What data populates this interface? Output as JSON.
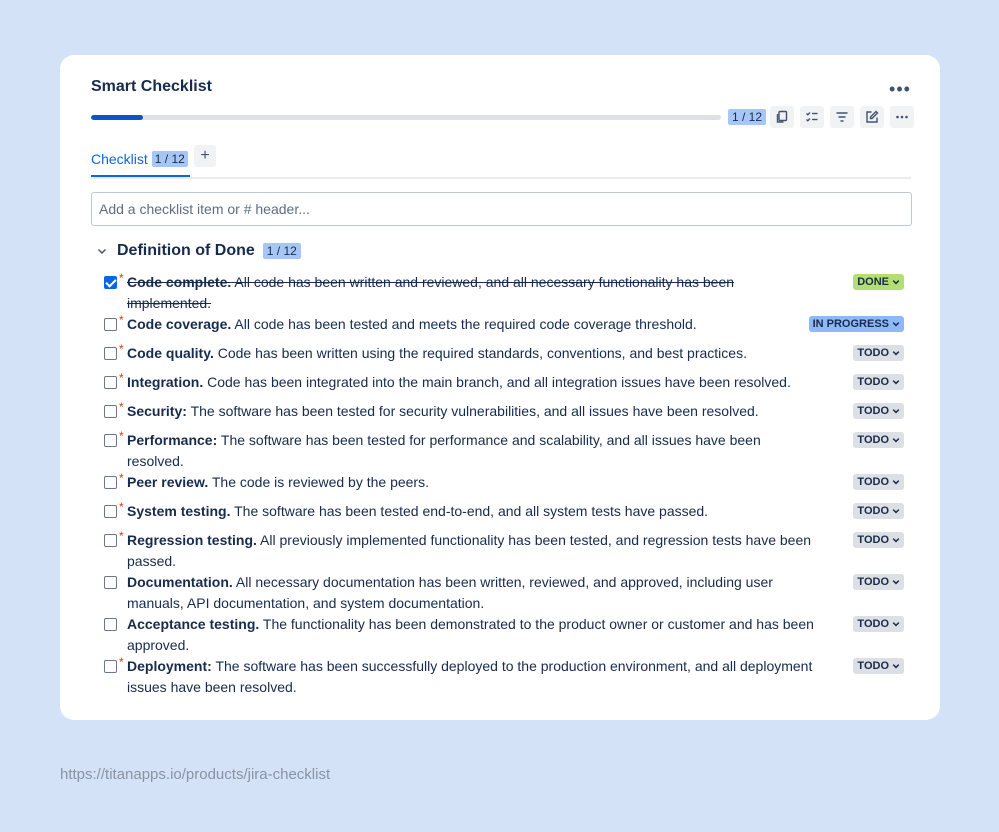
{
  "card": {
    "title": "Smart Checklist",
    "progress": {
      "done": 1,
      "total": 12,
      "fraction": 0.083,
      "label": "1 / 12"
    },
    "toolbar_icons": [
      "copy-icon",
      "checklist-icon",
      "filter-icon",
      "edit-icon",
      "more-icon"
    ]
  },
  "tabs": [
    {
      "label": "Checklist",
      "count": "1 / 12",
      "active": true
    }
  ],
  "tab_add": "+",
  "add_item": {
    "placeholder": "Add a checklist item or # header...",
    "value": ""
  },
  "section": {
    "title": "Definition of Done",
    "count": "1 / 12"
  },
  "items": [
    {
      "title": "Code complete.",
      "description": "All code has been written and reviewed, and all necessary functionality has been implemented.",
      "required": true,
      "checked": true,
      "status": "DONE"
    },
    {
      "title": "Code coverage.",
      "description": "All code has been tested and meets the required code coverage threshold.",
      "required": true,
      "checked": false,
      "status": "IN PROGRESS"
    },
    {
      "title": "Code quality.",
      "description": "Code has been written using the required standards, conventions, and best practices.",
      "required": true,
      "checked": false,
      "status": "TODO"
    },
    {
      "title": "Integration.",
      "description": "Code has been integrated into the main branch, and all integration issues have been resolved.",
      "required": true,
      "checked": false,
      "status": "TODO"
    },
    {
      "title": "Security:",
      "description": "The software has been tested for security vulnerabilities, and all issues have been resolved.",
      "required": true,
      "checked": false,
      "status": "TODO"
    },
    {
      "title": "Performance:",
      "description": "The software has been tested for performance and scalability, and all issues have been resolved.",
      "required": true,
      "checked": false,
      "status": "TODO"
    },
    {
      "title": "Peer review.",
      "description": "The code is reviewed by the peers.",
      "required": true,
      "checked": false,
      "status": "TODO"
    },
    {
      "title": "System testing.",
      "description": "The software has been tested end-to-end, and all system tests have passed.",
      "required": true,
      "checked": false,
      "status": "TODO"
    },
    {
      "title": "Regression testing.",
      "description": "All previously implemented functionality has been tested, and regression tests have been passed.",
      "required": true,
      "checked": false,
      "status": "TODO"
    },
    {
      "title": "Documentation.",
      "description": "All necessary documentation has been written, reviewed, and approved, including user manuals, API documentation, and system documentation.",
      "required": false,
      "checked": false,
      "status": "TODO"
    },
    {
      "title": "Acceptance testing.",
      "description": "The functionality has been demonstrated to the product owner or customer and has been approved.",
      "required": false,
      "checked": false,
      "status": "TODO"
    },
    {
      "title": "Deployment:",
      "description": "The software has been successfully deployed to the production environment, and all deployment issues have been resolved.",
      "required": true,
      "checked": false,
      "status": "TODO"
    }
  ],
  "status_colors": {
    "DONE": "#b3df72",
    "IN PROGRESS": "#8fb8f6",
    "TODO": "#dcdfe4"
  },
  "footer_url": "https://titanapps.io/products/jira-checklist"
}
